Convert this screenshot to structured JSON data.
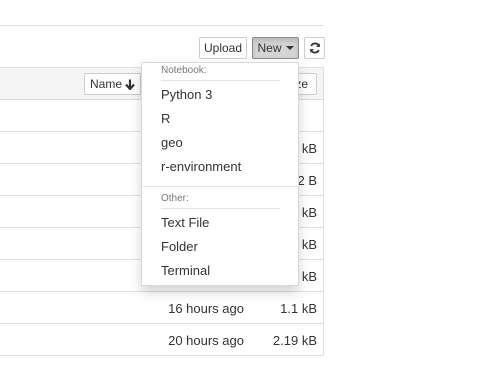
{
  "toolbar": {
    "upload_label": "Upload",
    "new_label": "New",
    "refresh_icon": "refresh-icon"
  },
  "list_header": {
    "name_label": "Name",
    "name_sort_icon": "arrow-down-icon",
    "size_label_visible": "ze"
  },
  "rows": [
    {
      "modified": "",
      "size": ""
    },
    {
      "modified": "",
      "size": "kB"
    },
    {
      "modified": "",
      "size": "2 B"
    },
    {
      "modified": "",
      "size": "kB"
    },
    {
      "modified": "",
      "size": "kB"
    },
    {
      "modified": "",
      "size": "kB"
    },
    {
      "modified": "16 hours ago",
      "size": "1.1 kB"
    },
    {
      "modified": "20 hours ago",
      "size": "2.19 kB"
    }
  ],
  "new_menu": {
    "notebook_header": "Notebook:",
    "notebook_items": [
      "Python 3",
      "R",
      "geo",
      "r-environment"
    ],
    "other_header": "Other:",
    "other_items": [
      "Text File",
      "Folder",
      "Terminal"
    ]
  }
}
